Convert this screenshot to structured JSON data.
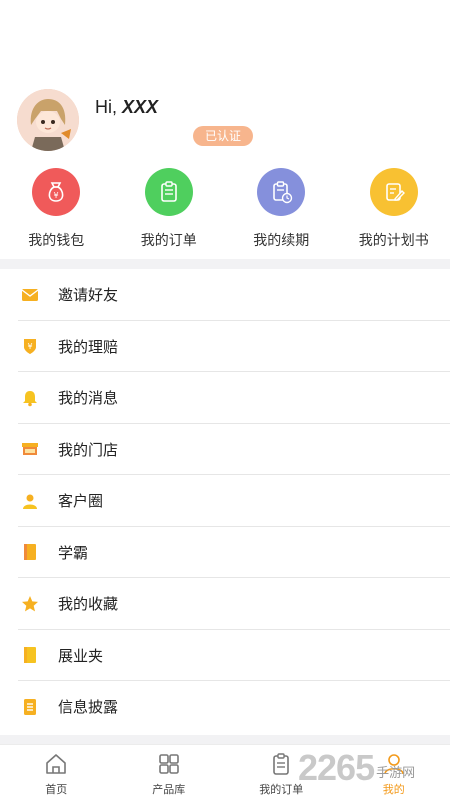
{
  "profile": {
    "greeting": "Hi,",
    "username": "XXX",
    "verified_badge": "已认证",
    "avatar_icon": "user-avatar"
  },
  "quick_actions": [
    {
      "label": "我的钱包",
      "icon": "money-bag-icon",
      "color": "#f05a5a"
    },
    {
      "label": "我的订单",
      "icon": "clipboard-icon",
      "color": "#4fcf5e"
    },
    {
      "label": "我的续期",
      "icon": "renewal-icon",
      "color": "#8590dc"
    },
    {
      "label": "我的计划书",
      "icon": "plan-icon",
      "color": "#f8c132"
    }
  ],
  "menu": [
    {
      "label": "邀请好友",
      "icon": "envelope-icon"
    },
    {
      "label": "我的理赔",
      "icon": "claim-shield-icon"
    },
    {
      "label": "我的消息",
      "icon": "bell-icon"
    },
    {
      "label": "我的门店",
      "icon": "store-icon"
    },
    {
      "label": "客户圈",
      "icon": "person-icon"
    },
    {
      "label": "学霸",
      "icon": "book-icon"
    },
    {
      "label": "我的收藏",
      "icon": "star-icon"
    },
    {
      "label": "展业夹",
      "icon": "folder-icon"
    },
    {
      "label": "信息披露",
      "icon": "list-icon"
    }
  ],
  "tabbar": [
    {
      "label": "首页",
      "icon": "home-icon"
    },
    {
      "label": "产品库",
      "icon": "grid-icon"
    },
    {
      "label": "我的订单",
      "icon": "order-icon"
    },
    {
      "label": "我的",
      "icon": "profile-icon",
      "active": true
    }
  ],
  "watermark": {
    "big": "2265",
    "small": "手游网"
  },
  "colors": {
    "accent": "#f39a1b",
    "menu_icon": "#f6b021",
    "divider": "#f2f2f4"
  }
}
